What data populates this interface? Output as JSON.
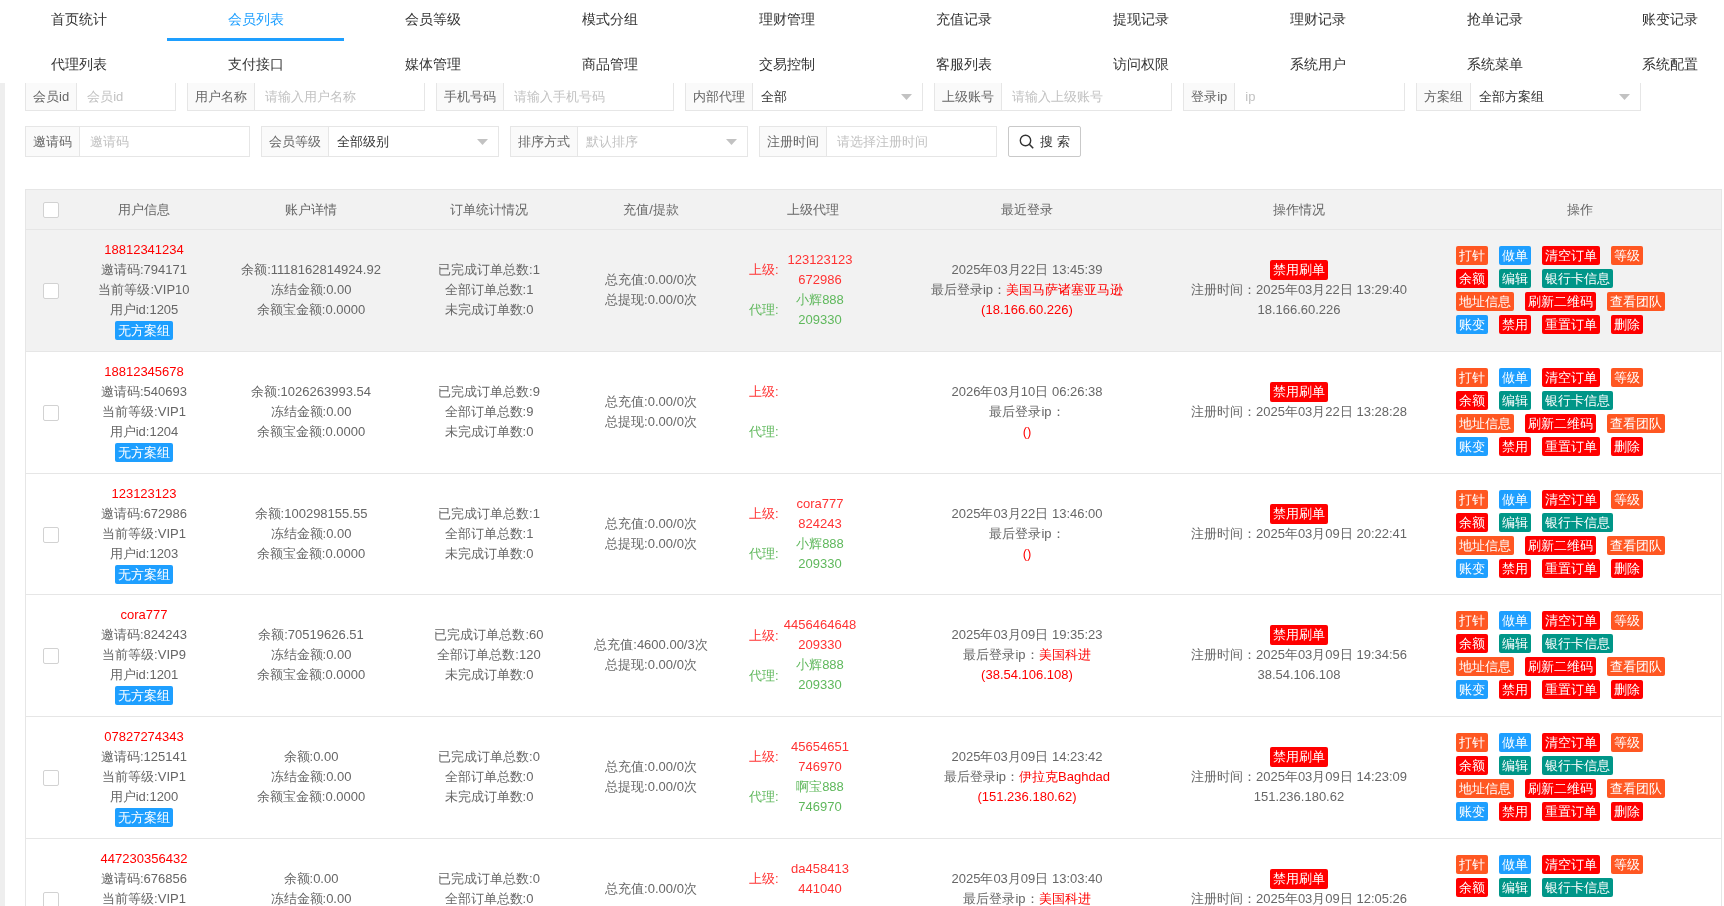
{
  "nav": [
    {
      "items": [
        {
          "label": "首页统计",
          "selected": false
        },
        {
          "label": "会员列表",
          "selected": true
        },
        {
          "label": "会员等级",
          "selected": false
        },
        {
          "label": "模式分组",
          "selected": false
        },
        {
          "label": "理财管理",
          "selected": false
        },
        {
          "label": "充值记录",
          "selected": false
        },
        {
          "label": "提现记录",
          "selected": false
        },
        {
          "label": "理财记录",
          "selected": false
        },
        {
          "label": "抢单记录",
          "selected": false
        },
        {
          "label": "账变记录",
          "selected": false
        }
      ]
    },
    {
      "items": [
        {
          "label": "代理列表",
          "selected": false
        },
        {
          "label": "支付接口",
          "selected": false
        },
        {
          "label": "媒体管理",
          "selected": false
        },
        {
          "label": "商品管理",
          "selected": false
        },
        {
          "label": "交易控制",
          "selected": false
        },
        {
          "label": "客服列表",
          "selected": false
        },
        {
          "label": "访问权限",
          "selected": false
        },
        {
          "label": "系统用户",
          "selected": false
        },
        {
          "label": "系统菜单",
          "selected": false
        },
        {
          "label": "系统配置",
          "selected": false
        }
      ]
    }
  ],
  "filters": [
    {
      "fields": [
        {
          "kind": "input",
          "label": "会员id",
          "placeholder": "会员id"
        },
        {
          "kind": "input",
          "label": "用户名称",
          "placeholder": "请输入用户名称"
        },
        {
          "kind": "input",
          "label": "手机号码",
          "placeholder": "请输入手机号码"
        },
        {
          "kind": "select",
          "label": "内部代理",
          "value": "全部"
        },
        {
          "kind": "input",
          "label": "上级账号",
          "placeholder": "请输入上级账号"
        },
        {
          "kind": "input",
          "label": "登录ip",
          "placeholder": "ip"
        },
        {
          "kind": "select",
          "label": "方案组",
          "value": "全部方案组"
        }
      ]
    },
    {
      "fields": [
        {
          "kind": "input",
          "label": "邀请码",
          "placeholder": "邀请码"
        },
        {
          "kind": "select",
          "label": "会员等级",
          "value": "全部级别"
        },
        {
          "kind": "select",
          "label": "排序方式",
          "placeholder": "默认排序"
        },
        {
          "kind": "input",
          "label": "注册时间",
          "placeholder": "请选择注册时间"
        },
        {
          "kind": "button",
          "label": "搜 索"
        }
      ]
    }
  ],
  "table": {
    "header_checkbox": {
      "checked": false
    },
    "columns": [
      "用户信息",
      "账户详情",
      "订单统计情况",
      "充值/提款",
      "上级代理",
      "最近登录",
      "操作情况",
      "操作"
    ],
    "rows": [
      {
        "highlighted": true,
        "checked": false,
        "user": {
          "phone": "18812341234",
          "invite": "邀请码:794171",
          "level": "当前等级:VIP10",
          "id": "用户id:1205",
          "tag": "无方案组"
        },
        "account": [
          "余额:1118162814924.92",
          "冻结金额:0.00",
          "余额宝金额:0.0000"
        ],
        "orders": [
          "已完成订单总数:1",
          "全部订单总数:1",
          "未完成订单数:0"
        ],
        "funds": [
          "总充值:0.00/0次",
          "总提现:0.00/0次"
        ],
        "upline": [
          {
            "kind": "superior",
            "label": "上级:",
            "lines": [
              "123123123",
              "672986"
            ]
          },
          {
            "kind": "agent",
            "label": "代理:",
            "lines": [
              "小辉888",
              "209330"
            ]
          }
        ],
        "login": {
          "time": "2025年03月22日 13:45:39",
          "ip_label": "最后登录ip：",
          "location": "美国马萨诸塞亚马逊",
          "ip": "(18.166.60.226)"
        },
        "status": {
          "button": "禁用刷单",
          "register_time": "注册时间：2025年03月22日 13:29:40",
          "register_ip": "18.166.60.226"
        },
        "actions": [
          [
            {
              "label": "打针",
              "color": "#ff5722"
            },
            {
              "label": "做单",
              "color": "#1e9fff"
            },
            {
              "label": "清空订单",
              "color": "#ff0000"
            },
            {
              "label": "等级",
              "color": "#ff5722"
            }
          ],
          [
            {
              "label": "余额",
              "color": "#ff0000"
            },
            {
              "label": "编辑",
              "color": "#009688"
            },
            {
              "label": "银行卡信息",
              "color": "#009688"
            }
          ],
          [
            {
              "label": "地址信息",
              "color": "#ff5722"
            },
            {
              "label": "刷新二维码",
              "color": "#ff0000"
            },
            {
              "label": "查看团队",
              "color": "#ff5722"
            }
          ],
          [
            {
              "label": "账变",
              "color": "#1e9fff"
            },
            {
              "label": "禁用",
              "color": "#ff0000"
            },
            {
              "label": "重置订单",
              "color": "#ff0000"
            },
            {
              "label": "删除",
              "color": "#ff0000"
            }
          ]
        ]
      },
      {
        "highlighted": false,
        "checked": false,
        "user": {
          "phone": "18812345678",
          "invite": "邀请码:540693",
          "level": "当前等级:VIP1",
          "id": "用户id:1204",
          "tag": "无方案组"
        },
        "account": [
          "余额:1026263993.54",
          "冻结金额:0.00",
          "余额宝金额:0.0000"
        ],
        "orders": [
          "已完成订单总数:9",
          "全部订单总数:9",
          "未完成订单数:0"
        ],
        "funds": [
          "总充值:0.00/0次",
          "总提现:0.00/0次"
        ],
        "upline": [
          {
            "kind": "superior",
            "label": "上级:"
          },
          {
            "kind": "agent",
            "label": "代理:"
          }
        ],
        "login": {
          "time": "2026年03月10日 06:26:38",
          "ip_label": "最后登录ip：",
          "ip": "()"
        },
        "status": {
          "button": "禁用刷单",
          "register_time": "注册时间：2025年03月22日 13:28:28"
        },
        "actions": [
          [
            {
              "label": "打针",
              "color": "#ff5722"
            },
            {
              "label": "做单",
              "color": "#1e9fff"
            },
            {
              "label": "清空订单",
              "color": "#ff0000"
            },
            {
              "label": "等级",
              "color": "#ff5722"
            }
          ],
          [
            {
              "label": "余额",
              "color": "#ff0000"
            },
            {
              "label": "编辑",
              "color": "#009688"
            },
            {
              "label": "银行卡信息",
              "color": "#009688"
            }
          ],
          [
            {
              "label": "地址信息",
              "color": "#ff5722"
            },
            {
              "label": "刷新二维码",
              "color": "#ff0000"
            },
            {
              "label": "查看团队",
              "color": "#ff5722"
            }
          ],
          [
            {
              "label": "账变",
              "color": "#1e9fff"
            },
            {
              "label": "禁用",
              "color": "#ff0000"
            },
            {
              "label": "重置订单",
              "color": "#ff0000"
            },
            {
              "label": "删除",
              "color": "#ff0000"
            }
          ]
        ]
      },
      {
        "highlighted": false,
        "checked": false,
        "user": {
          "phone": "123123123",
          "invite": "邀请码:672986",
          "level": "当前等级:VIP1",
          "id": "用户id:1203",
          "tag": "无方案组"
        },
        "account": [
          "余额:100298155.55",
          "冻结金额:0.00",
          "余额宝金额:0.0000"
        ],
        "orders": [
          "已完成订单总数:1",
          "全部订单总数:1",
          "未完成订单数:0"
        ],
        "funds": [
          "总充值:0.00/0次",
          "总提现:0.00/0次"
        ],
        "upline": [
          {
            "kind": "superior",
            "label": "上级:",
            "lines": [
              "cora777",
              "824243"
            ]
          },
          {
            "kind": "agent",
            "label": "代理:",
            "lines": [
              "小辉888",
              "209330"
            ]
          }
        ],
        "login": {
          "time": "2025年03月22日 13:46:00",
          "ip_label": "最后登录ip：",
          "ip": "()"
        },
        "status": {
          "button": "禁用刷单",
          "register_time": "注册时间：2025年03月09日 20:22:41"
        },
        "actions": [
          [
            {
              "label": "打针",
              "color": "#ff5722"
            },
            {
              "label": "做单",
              "color": "#1e9fff"
            },
            {
              "label": "清空订单",
              "color": "#ff0000"
            },
            {
              "label": "等级",
              "color": "#ff5722"
            }
          ],
          [
            {
              "label": "余额",
              "color": "#ff0000"
            },
            {
              "label": "编辑",
              "color": "#009688"
            },
            {
              "label": "银行卡信息",
              "color": "#009688"
            }
          ],
          [
            {
              "label": "地址信息",
              "color": "#ff5722"
            },
            {
              "label": "刷新二维码",
              "color": "#ff0000"
            },
            {
              "label": "查看团队",
              "color": "#ff5722"
            }
          ],
          [
            {
              "label": "账变",
              "color": "#1e9fff"
            },
            {
              "label": "禁用",
              "color": "#ff0000"
            },
            {
              "label": "重置订单",
              "color": "#ff0000"
            },
            {
              "label": "删除",
              "color": "#ff0000"
            }
          ]
        ]
      },
      {
        "highlighted": false,
        "checked": false,
        "user": {
          "phone": "cora777",
          "invite": "邀请码:824243",
          "level": "当前等级:VIP9",
          "id": "用户id:1201",
          "tag": "无方案组"
        },
        "account": [
          "余额:70519626.51",
          "冻结金额:0.00",
          "余额宝金额:0.0000"
        ],
        "orders": [
          "已完成订单总数:60",
          "全部订单总数:120",
          "未完成订单数:0"
        ],
        "funds": [
          "总充值:4600.00/3次",
          "总提现:0.00/0次"
        ],
        "upline": [
          {
            "kind": "superior",
            "label": "上级:",
            "lines": [
              "4456464648",
              "209330"
            ]
          },
          {
            "kind": "agent",
            "label": "代理:",
            "lines": [
              "小辉888",
              "209330"
            ]
          }
        ],
        "login": {
          "time": "2025年03月09日 19:35:23",
          "ip_label": "最后登录ip：",
          "location": "美国科进",
          "ip": "(38.54.106.108)"
        },
        "status": {
          "button": "禁用刷单",
          "register_time": "注册时间：2025年03月09日 19:34:56",
          "register_ip": "38.54.106.108"
        },
        "actions": [
          [
            {
              "label": "打针",
              "color": "#ff5722"
            },
            {
              "label": "做单",
              "color": "#1e9fff"
            },
            {
              "label": "清空订单",
              "color": "#ff0000"
            },
            {
              "label": "等级",
              "color": "#ff5722"
            }
          ],
          [
            {
              "label": "余额",
              "color": "#ff0000"
            },
            {
              "label": "编辑",
              "color": "#009688"
            },
            {
              "label": "银行卡信息",
              "color": "#009688"
            }
          ],
          [
            {
              "label": "地址信息",
              "color": "#ff5722"
            },
            {
              "label": "刷新二维码",
              "color": "#ff0000"
            },
            {
              "label": "查看团队",
              "color": "#ff5722"
            }
          ],
          [
            {
              "label": "账变",
              "color": "#1e9fff"
            },
            {
              "label": "禁用",
              "color": "#ff0000"
            },
            {
              "label": "重置订单",
              "color": "#ff0000"
            },
            {
              "label": "删除",
              "color": "#ff0000"
            }
          ]
        ]
      },
      {
        "highlighted": false,
        "checked": false,
        "user": {
          "phone": "07827274343",
          "invite": "邀请码:125141",
          "level": "当前等级:VIP1",
          "id": "用户id:1200",
          "tag": "无方案组"
        },
        "account": [
          "余额:0.00",
          "冻结金额:0.00",
          "余额宝金额:0.0000"
        ],
        "orders": [
          "已完成订单总数:0",
          "全部订单总数:0",
          "未完成订单数:0"
        ],
        "funds": [
          "总充值:0.00/0次",
          "总提现:0.00/0次"
        ],
        "upline": [
          {
            "kind": "superior",
            "label": "上级:",
            "lines": [
              "45654651",
              "746970"
            ]
          },
          {
            "kind": "agent",
            "label": "代理:",
            "lines": [
              "啊宝888",
              "746970"
            ]
          }
        ],
        "login": {
          "time": "2025年03月09日 14:23:42",
          "ip_label": "最后登录ip：",
          "location": "伊拉克Baghdad",
          "ip": "(151.236.180.62)"
        },
        "status": {
          "button": "禁用刷单",
          "register_time": "注册时间：2025年03月09日 14:23:09",
          "register_ip": "151.236.180.62"
        },
        "actions": [
          [
            {
              "label": "打针",
              "color": "#ff5722"
            },
            {
              "label": "做单",
              "color": "#1e9fff"
            },
            {
              "label": "清空订单",
              "color": "#ff0000"
            },
            {
              "label": "等级",
              "color": "#ff5722"
            }
          ],
          [
            {
              "label": "余额",
              "color": "#ff0000"
            },
            {
              "label": "编辑",
              "color": "#009688"
            },
            {
              "label": "银行卡信息",
              "color": "#009688"
            }
          ],
          [
            {
              "label": "地址信息",
              "color": "#ff5722"
            },
            {
              "label": "刷新二维码",
              "color": "#ff0000"
            },
            {
              "label": "查看团队",
              "color": "#ff5722"
            }
          ],
          [
            {
              "label": "账变",
              "color": "#1e9fff"
            },
            {
              "label": "禁用",
              "color": "#ff0000"
            },
            {
              "label": "重置订单",
              "color": "#ff0000"
            },
            {
              "label": "删除",
              "color": "#ff0000"
            }
          ]
        ]
      },
      {
        "highlighted": false,
        "checked": false,
        "user": {
          "phone": "447230356432",
          "invite": "邀请码:676856",
          "level": "当前等级:VIP1"
        },
        "account": [
          "余额:0.00",
          "冻结金额:0.00"
        ],
        "orders": [
          "已完成订单总数:0",
          "全部订单总数:0"
        ],
        "funds": [
          "总充值:0.00/0次"
        ],
        "upline": [
          {
            "kind": "superior",
            "label": "上级:",
            "lines": [
              "da458413",
              "441040"
            ]
          }
        ],
        "login": {
          "time": "2025年03月09日 13:03:40",
          "ip_label": "最后登录ip：",
          "location": "美国科进"
        },
        "status": {
          "button": "禁用刷单",
          "register_time": "注册时间：2025年03月09日 12:05:26"
        },
        "actions": [
          [
            {
              "label": "打针",
              "color": "#ff5722"
            },
            {
              "label": "做单",
              "color": "#1e9fff"
            },
            {
              "label": "清空订单",
              "color": "#ff0000"
            },
            {
              "label": "等级",
              "color": "#ff5722"
            }
          ],
          [
            {
              "label": "余额",
              "color": "#ff0000"
            },
            {
              "label": "编辑",
              "color": "#009688"
            },
            {
              "label": "银行卡信息",
              "color": "#009688"
            }
          ]
        ]
      }
    ]
  }
}
